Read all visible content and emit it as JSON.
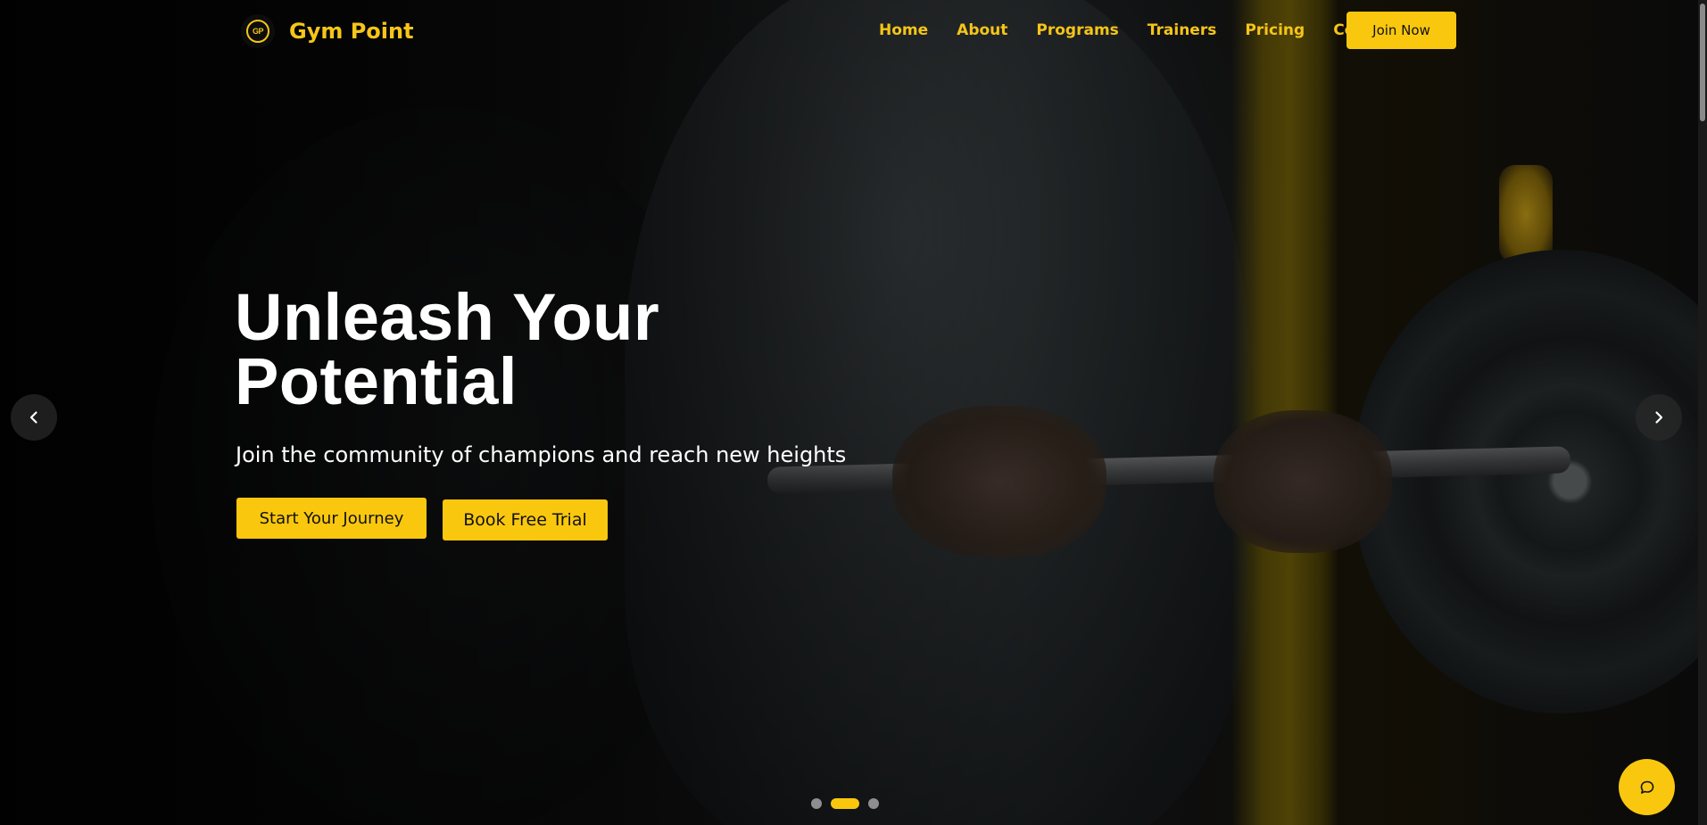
{
  "brand": {
    "logo_text": "GP",
    "name": "Gym Point"
  },
  "nav": {
    "items": [
      "Home",
      "About",
      "Programs",
      "Trainers",
      "Pricing",
      "Contact"
    ],
    "cta": "Join Now"
  },
  "hero": {
    "title_line1": "Unleash Your",
    "title_line2": "Potential",
    "subtitle": "Join the community of champions and reach new heights",
    "primary_button": "Start Your Journey",
    "secondary_button": "Book Free Trial"
  },
  "carousel": {
    "slides": 3,
    "active_slide": 2,
    "prev_icon": "chevron-left-icon",
    "next_icon": "chevron-right-icon"
  },
  "chat": {
    "icon": "chat-bubble-icon"
  },
  "colors": {
    "accent": "#f9c80e",
    "brand_text": "#f5c518",
    "background": "#0b0b0b"
  }
}
